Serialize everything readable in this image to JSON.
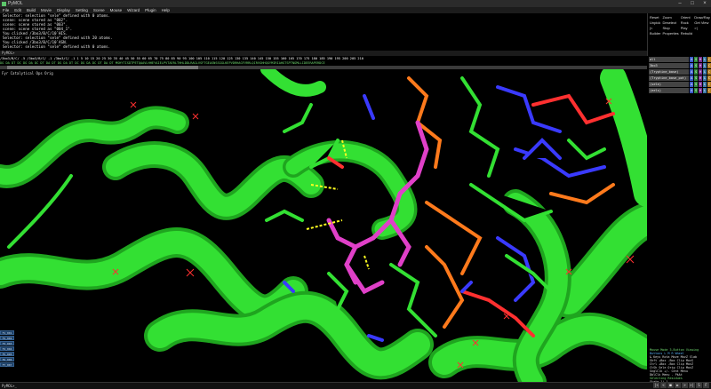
{
  "window": {
    "title": "PyMOL",
    "controls": [
      "–",
      "□",
      "×"
    ]
  },
  "menu": [
    "File",
    "Edit",
    "Build",
    "Movie",
    "Display",
    "Setting",
    "Scene",
    "Mouse",
    "Wizard",
    "Plugin",
    "Help"
  ],
  "console_lines": [
    " Selector: selection \"sele\" defined with 0 atoms.",
    " scene: scene stored as \"002\".",
    " scene: scene stored as \"003\".",
    " scene: scene stored as \"004_1\".",
    " You clicked /3bo3/B/C/10`HIS.",
    " Selector: selection \"sele\" defined with 20 atoms.",
    " You clicked /3bo3/B/C/10`ASN.",
    " Selector: selection \"sele\" defined with 0 atoms."
  ],
  "command": {
    "prompt": "PyMOL>"
  },
  "external_buttons": [
    "Reset",
    "Zoom",
    "Orient",
    "Draw/Ray",
    "Unpick",
    "Deselect",
    "Rock",
    "Get View",
    "|<",
    "Stop",
    "Play",
    ">|",
    "Builder",
    "Properties",
    "Rebuild"
  ],
  "sequence": {
    "line1": "/3bo3/B/C/ -5          /3bo3/B/C/ -1              /3bo3/C/ -1  1  5   10   15   20   25   30   35   40   45   50   55   60   65   70   75   80   85   90   95  100  105  110  115  120  125  130  135  140  145  150  155  160  165  170  175  180  185  190  195  200  205  210",
    "line2": "DG DA DT DC DG DA DC DT DA DT    DG DA DT DC DG DA DC DT DA DT    MSHYTISDTPETQAAVLHHEYAIELPVTAERLTHHLDDLRAGLVSFTGEASNSSGGLKEPVDRHAGFVRRLQIRVGHHQGYMIRIAHGTSPTNGMLLIDEERAPERDCE"
  },
  "scene_title": "Fyr Catalytical Ops Orig",
  "scenes": [
    "F1_001",
    "F2_002",
    "F3_003",
    "F4_004",
    "F5_005",
    "F6_006",
    "F7_007"
  ],
  "objects": [
    {
      "name": "all"
    },
    {
      "name": "3bo3"
    },
    {
      "name": "(Tryptine_base)"
    },
    {
      "name": "(Tryptine_base_pot)"
    },
    {
      "name": "(sele)"
    },
    {
      "name": "(eels)"
    }
  ],
  "ashlc": [
    "A",
    "S",
    "H",
    "L",
    "C"
  ],
  "mouse_panel": {
    "line1": "Mouse Mode 3-Button Viewing",
    "line2": "Buttons   L    M    R  Wheel",
    "line3": " & Keys  Rota Move MovZ Slab",
    "line4": "  Shft  +Box -Box Clip MovS",
    "line5": "  Ctrl  +Box -Box Clip MovZ",
    "line6": "  CtSh  Sele Orig Clip MovZ",
    "line7": "SnglClk +/-  Cent Menu",
    "line8": "DblClk  Menu  -   PkAt",
    "line9": "Selecting Residues",
    "line10": "State    1/   1"
  },
  "status": {
    "prompt": "PyMOL>_"
  },
  "movie_controls": [
    "|<",
    "<",
    "■",
    "▶",
    ">",
    ">|",
    "S",
    "F"
  ],
  "colors": {
    "protein": "#2fdc2f",
    "ligand": "#e040c8",
    "carbon_dna": "#ff7a1c",
    "oxygen": "#ff3030",
    "nitrogen": "#3030ff",
    "hbond": "#ffff20"
  }
}
